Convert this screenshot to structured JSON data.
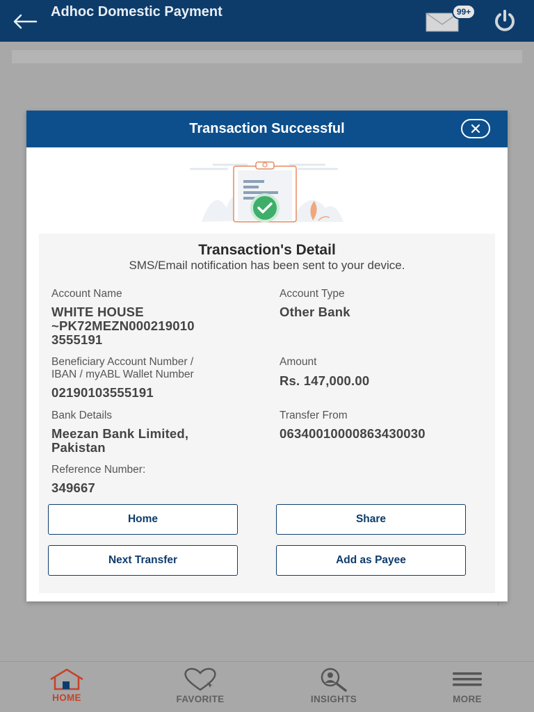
{
  "header": {
    "title": "Adhoc Domestic Payment",
    "mail_badge": "99+",
    "icons": {
      "back": "back-arrow-icon",
      "mail": "mail-icon",
      "power": "power-icon"
    }
  },
  "modal": {
    "title": "Transaction Successful",
    "illustration": "clipboard-success-illustration",
    "detail_title": "Transaction's Detail",
    "detail_subtitle": "SMS/Email notification has been sent to your device.",
    "fields": {
      "account_name": {
        "label": "Account Name",
        "value_lines": [
          "WHITE HOUSE",
          "~PK72MEZN000219010",
          "3555191"
        ]
      },
      "account_type": {
        "label": "Account Type",
        "value": "Other Bank"
      },
      "beneficiary": {
        "label_lines": [
          "Beneficiary Account Number /",
          "IBAN / myABL Wallet Number"
        ],
        "value": "02190103555191"
      },
      "amount": {
        "label": "Amount",
        "value": "Rs. 147,000.00"
      },
      "bank_details": {
        "label": "Bank Details",
        "value_lines": [
          "Meezan Bank Limited,",
          "Pakistan"
        ]
      },
      "transfer_from": {
        "label": "Transfer From",
        "value": "06340010000863430030"
      },
      "reference": {
        "label": "Reference Number:",
        "value": "349667"
      }
    },
    "buttons": {
      "home": "Home",
      "share": "Share",
      "next_transfer": "Next Transfer",
      "add_payee": "Add as Payee"
    }
  },
  "bottom_nav": {
    "items": [
      {
        "label": "HOME",
        "icon": "home-icon",
        "active": true
      },
      {
        "label": "FAVORITE",
        "icon": "heart-icon",
        "active": false
      },
      {
        "label": "INSIGHTS",
        "icon": "insights-search-icon",
        "active": false
      },
      {
        "label": "MORE",
        "icon": "menu-icon",
        "active": false
      }
    ]
  },
  "colors": {
    "header": "#0d3c6b",
    "modal_header": "#0d4f8c",
    "success_green": "#3fae6a",
    "active_nav": "#c4432a",
    "overlay": "#a8a8a8"
  }
}
